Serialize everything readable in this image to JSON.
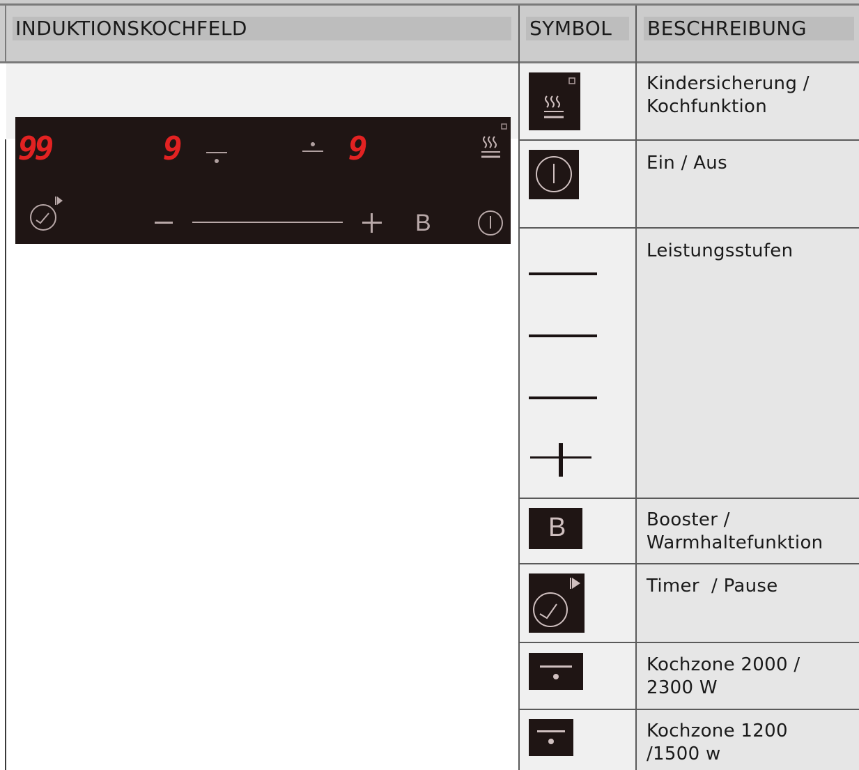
{
  "header": {
    "col1": "INDUKTIONSKOCHFELD",
    "col2": "SYMBOL",
    "col3": "BESCHREIBUNG"
  },
  "panel": {
    "timer_display": "99",
    "zone_left_display": "9",
    "zone_right_display": "9",
    "booster_label": "B"
  },
  "rows": [
    {
      "icon": "lock-steam-icon",
      "description": "Kindersicherung /\nKochfunktion"
    },
    {
      "icon": "power-icon",
      "description": "Ein / Aus"
    },
    {
      "icon": "slider-lines-icon",
      "description": "Leistungsstufen"
    },
    {
      "icon": "booster-icon",
      "symbol_text": "B",
      "description": "Booster /\nWarmhaltefunktion"
    },
    {
      "icon": "timer-icon",
      "description": "Timer  / Pause"
    },
    {
      "icon": "zone-large-icon",
      "description": "Kochzone 2000 /\n2300 W"
    },
    {
      "icon": "zone-small-icon",
      "description": "Kochzone 1200\n/1500 w"
    }
  ]
}
